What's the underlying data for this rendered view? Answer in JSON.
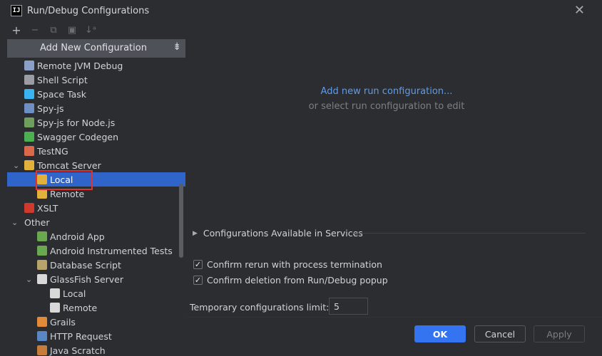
{
  "window": {
    "title": "Run/Debug Configurations",
    "icon_text": "IJ"
  },
  "toolbar": {
    "add": "+",
    "remove": "−",
    "copy": "⧉",
    "folder": "▣",
    "sort": "↓ᵃ"
  },
  "add_new_label": "Add New Configuration",
  "tree": [
    {
      "label": "Remote JVM Debug",
      "icon": "remote-jvm-debug-icon",
      "color": "#8aa0c8",
      "indent": 1
    },
    {
      "label": "Shell Script",
      "icon": "shell-script-icon",
      "color": "#9a9ea4",
      "indent": 1
    },
    {
      "label": "Space Task",
      "icon": "space-task-icon",
      "color": "#39b4f0",
      "indent": 1
    },
    {
      "label": "Spy-js",
      "icon": "spy-js-icon",
      "color": "#6e8fc4",
      "indent": 1
    },
    {
      "label": "Spy-js for Node.js",
      "icon": "spy-js-node-icon",
      "color": "#6e9f5c",
      "indent": 1
    },
    {
      "label": "Swagger Codegen",
      "icon": "swagger-icon",
      "color": "#4caf50",
      "indent": 1
    },
    {
      "label": "TestNG",
      "icon": "testng-icon",
      "color": "#d9694a",
      "indent": 1
    },
    {
      "label": "Tomcat Server",
      "icon": "tomcat-icon",
      "color": "#e2b13c",
      "indent": 1,
      "chevron": "down"
    },
    {
      "label": "Local",
      "icon": "tomcat-local-icon",
      "color": "#e2b13c",
      "indent": 2,
      "selected": true
    },
    {
      "label": "Remote",
      "icon": "tomcat-remote-icon",
      "color": "#e2b13c",
      "indent": 2
    },
    {
      "label": "XSLT",
      "icon": "xslt-icon",
      "color": "#d0392e",
      "indent": 1
    },
    {
      "label": "Other",
      "icon": "",
      "color": "",
      "indent": 0,
      "chevron": "down"
    },
    {
      "label": "Android App",
      "icon": "android-icon",
      "color": "#6aa84f",
      "indent": 2
    },
    {
      "label": "Android Instrumented Tests",
      "icon": "android-tests-icon",
      "color": "#6aa84f",
      "indent": 2
    },
    {
      "label": "Database Script",
      "icon": "database-icon",
      "color": "#b8a46a",
      "indent": 2
    },
    {
      "label": "GlassFish Server",
      "icon": "glassfish-icon",
      "color": "#d8d8d8",
      "indent": 2,
      "chevron": "down"
    },
    {
      "label": "Local",
      "icon": "glassfish-local-icon",
      "color": "#d8d8d8",
      "indent": 3
    },
    {
      "label": "Remote",
      "icon": "glassfish-remote-icon",
      "color": "#d8d8d8",
      "indent": 3
    },
    {
      "label": "Grails",
      "icon": "grails-icon",
      "color": "#e08a3a",
      "indent": 2
    },
    {
      "label": "HTTP Request",
      "icon": "http-request-icon",
      "color": "#5a87c4",
      "indent": 2
    },
    {
      "label": "Java Scratch",
      "icon": "java-scratch-icon",
      "color": "#c77c3a",
      "indent": 2
    }
  ],
  "right": {
    "link": "Add new run configuration...",
    "hint": "or select run configuration to edit",
    "services": "Configurations Available in Services",
    "check1": "Confirm rerun with process termination",
    "check2": "Confirm deletion from Run/Debug popup",
    "limit_label": "Temporary configurations limit:",
    "limit_value": "5"
  },
  "buttons": {
    "ok": "OK",
    "cancel": "Cancel",
    "apply": "Apply"
  }
}
